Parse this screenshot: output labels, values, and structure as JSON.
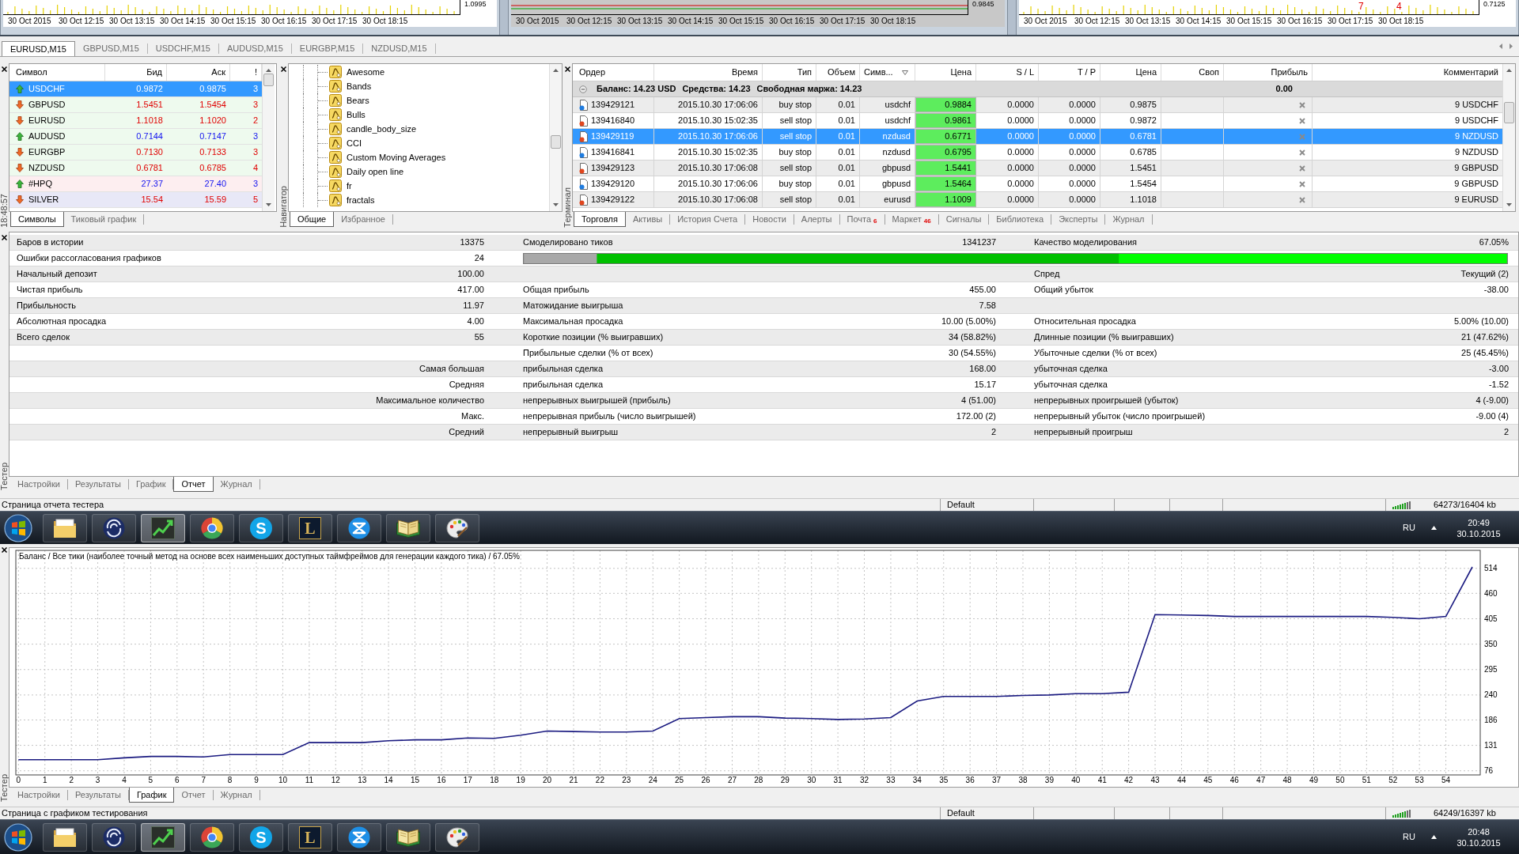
{
  "top_charts": [
    {
      "kind": "volumes",
      "price_label": "1.0995",
      "time_labels": [
        "30 Oct 2015",
        "30 Oct 12:15",
        "30 Oct 13:15",
        "30 Oct 14:15",
        "30 Oct 15:15",
        "30 Oct 16:15",
        "30 Oct 17:15",
        "30 Oct 18:15"
      ]
    },
    {
      "kind": "levels",
      "price_label": "0.9845",
      "time_labels": [
        "30 Oct 2015",
        "30 Oct 12:15",
        "30 Oct 13:15",
        "30 Oct 14:15",
        "30 Oct 15:15",
        "30 Oct 16:15",
        "30 Oct 17:15",
        "30 Oct 18:15"
      ]
    },
    {
      "kind": "markers",
      "price_label": "0.7125",
      "markers": [
        "7",
        "4"
      ],
      "time_labels": [
        "30 Oct 2015",
        "30 Oct 12:15",
        "30 Oct 13:15",
        "30 Oct 14:15",
        "30 Oct 15:15",
        "30 Oct 16:15",
        "30 Oct 17:15",
        "30 Oct 18:15"
      ]
    }
  ],
  "chart_tabs": [
    {
      "label": "EURUSD,M15",
      "selected": true
    },
    {
      "label": "GBPUSD,M15",
      "selected": false
    },
    {
      "label": "USDCHF,M15",
      "selected": false
    },
    {
      "label": "AUDUSD,M15",
      "selected": false
    },
    {
      "label": "EURGBP,M15",
      "selected": false
    },
    {
      "label": "NZDUSD,M15",
      "selected": false
    }
  ],
  "market_watch": {
    "clock": "18:48:57",
    "columns": [
      "Символ",
      "Бид",
      "Аск",
      "!"
    ],
    "rows": [
      {
        "symbol": "USDCHF",
        "bid": "0.9872",
        "ask": "0.9875",
        "spread": "3",
        "rising": true,
        "selected": true
      },
      {
        "symbol": "GBPUSD",
        "bid": "1.5451",
        "ask": "1.5454",
        "spread": "3",
        "rising": false,
        "selected": false,
        "color": "#eefaee"
      },
      {
        "symbol": "EURUSD",
        "bid": "1.1018",
        "ask": "1.1020",
        "spread": "2",
        "rising": false,
        "selected": false,
        "color": "#eefaee"
      },
      {
        "symbol": "AUDUSD",
        "bid": "0.7144",
        "ask": "0.7147",
        "spread": "3",
        "rising": true,
        "selected": false,
        "color": "#eefaee"
      },
      {
        "symbol": "EURGBP",
        "bid": "0.7130",
        "ask": "0.7133",
        "spread": "3",
        "rising": false,
        "selected": false,
        "color": "#eefaee"
      },
      {
        "symbol": "NZDUSD",
        "bid": "0.6781",
        "ask": "0.6785",
        "spread": "4",
        "rising": false,
        "selected": false,
        "color": "#eefaee"
      },
      {
        "symbol": "#HPQ",
        "bid": "27.37",
        "ask": "27.40",
        "spread": "3",
        "rising": true,
        "selected": false,
        "color": "#fdeef0"
      },
      {
        "symbol": "SILVER",
        "bid": "15.54",
        "ask": "15.59",
        "spread": "5",
        "rising": false,
        "selected": false,
        "color": "#e8e8f7"
      }
    ],
    "tabs": [
      {
        "label": "Символы",
        "selected": true
      },
      {
        "label": "Тиковый график",
        "selected": false
      }
    ]
  },
  "navigator": {
    "title": "Навигатор",
    "items": [
      "Awesome",
      "Bands",
      "Bears",
      "Bulls",
      "candle_body_size",
      "CCI",
      "Custom Moving Averages",
      "Daily open line",
      "fr",
      "fractals"
    ],
    "tabs": [
      {
        "label": "Общие",
        "selected": true
      },
      {
        "label": "Избранное",
        "selected": false
      }
    ]
  },
  "terminal": {
    "title": "Терминал",
    "columns": [
      "Ордер",
      "Время",
      "Тип",
      "Объем",
      "Симв...",
      "Цена",
      "S / L",
      "T / P",
      "Цена",
      "Своп",
      "Прибыль",
      "Комментарий"
    ],
    "summary": [
      "Баланс: 14.23 USD",
      "Средства: 14.23",
      "Свободная маржа: 14.23"
    ],
    "summary_profit": "0.00",
    "rows": [
      {
        "kind": "buy",
        "selected": false,
        "order": "139429121",
        "time": "2015.10.30 17:06:06",
        "type": "buy stop",
        "volume": "0.01",
        "symbol": "usdchf",
        "price": "0.9884",
        "sl": "0.0000",
        "tp": "0.0000",
        "current_price": "0.9875",
        "comment": "9 USDCHF"
      },
      {
        "kind": "sell",
        "selected": false,
        "order": "139416840",
        "time": "2015.10.30 15:02:35",
        "type": "sell stop",
        "volume": "0.01",
        "symbol": "usdchf",
        "price": "0.9861",
        "sl": "0.0000",
        "tp": "0.0000",
        "current_price": "0.9872",
        "comment": "9 USDCHF"
      },
      {
        "kind": "sell",
        "selected": true,
        "order": "139429119",
        "time": "2015.10.30 17:06:06",
        "type": "sell stop",
        "volume": "0.01",
        "symbol": "nzdusd",
        "price": "0.6771",
        "sl": "0.0000",
        "tp": "0.0000",
        "current_price": "0.6781",
        "comment": "9 NZDUSD"
      },
      {
        "kind": "buy",
        "selected": false,
        "order": "139416841",
        "time": "2015.10.30 15:02:35",
        "type": "buy stop",
        "volume": "0.01",
        "symbol": "nzdusd",
        "price": "0.6795",
        "sl": "0.0000",
        "tp": "0.0000",
        "current_price": "0.6785",
        "comment": "9 NZDUSD"
      },
      {
        "kind": "sell",
        "selected": false,
        "order": "139429123",
        "time": "2015.10.30 17:06:08",
        "type": "sell stop",
        "volume": "0.01",
        "symbol": "gbpusd",
        "price": "1.5441",
        "sl": "0.0000",
        "tp": "0.0000",
        "current_price": "1.5451",
        "comment": "9 GBPUSD"
      },
      {
        "kind": "buy",
        "selected": false,
        "order": "139429120",
        "time": "2015.10.30 17:06:06",
        "type": "buy stop",
        "volume": "0.01",
        "symbol": "gbpusd",
        "price": "1.5464",
        "sl": "0.0000",
        "tp": "0.0000",
        "current_price": "1.5454",
        "comment": "9 GBPUSD"
      },
      {
        "kind": "sell",
        "selected": false,
        "order": "139429122",
        "time": "2015.10.30 17:06:08",
        "type": "sell stop",
        "volume": "0.01",
        "symbol": "eurusd",
        "price": "1.1009",
        "sl": "0.0000",
        "tp": "0.0000",
        "current_price": "1.1018",
        "comment": "9 EURUSD"
      }
    ],
    "tabs": [
      {
        "label": "Торговля",
        "selected": true
      },
      {
        "label": "Активы",
        "selected": false
      },
      {
        "label": "История Счета",
        "selected": false
      },
      {
        "label": "Новости",
        "selected": false
      },
      {
        "label": "Алерты",
        "selected": false
      },
      {
        "label": "Почта",
        "count": "6",
        "selected": false
      },
      {
        "label": "Маркет",
        "count": "46",
        "selected": false
      },
      {
        "label": "Сигналы",
        "selected": false
      },
      {
        "label": "Библиотека",
        "selected": false
      },
      {
        "label": "Эксперты",
        "selected": false
      },
      {
        "label": "Журнал",
        "selected": false
      }
    ]
  },
  "tester_report": {
    "title": "Тестер",
    "rows": [
      {
        "kind": "text",
        "label": "Баров в истории",
        "value": "13375",
        "label_2": "Смоделировано тиков",
        "value_2": "1341237",
        "label_3": "Качество моделирования",
        "value_3": "67.05%"
      },
      {
        "kind": "quality_bar",
        "label": "Ошибки рассогласования графиков",
        "value": "24"
      },
      {
        "kind": "text",
        "label": "Начальный депозит",
        "value": "100.00",
        "label_3": "Спред",
        "value_3": "Текущий (2)"
      },
      {
        "kind": "text",
        "label": "Чистая прибыль",
        "value": "417.00",
        "label_2": "Общая прибыль",
        "value_2": "455.00",
        "label_3": "Общий убыток",
        "value_3": "-38.00"
      },
      {
        "kind": "text",
        "label": "Прибыльность",
        "value": "11.97",
        "label_2": "Матожидание выигрыша",
        "value_2": "7.58"
      },
      {
        "kind": "text",
        "label": "Абсолютная просадка",
        "value": "4.00",
        "label_2": "Максимальная просадка",
        "value_2": "10.00 (5.00%)",
        "label_3": "Относительная просадка",
        "value_3": "5.00% (10.00)"
      },
      {
        "kind": "text",
        "label": "Всего сделок",
        "value": "55",
        "label_2": "Короткие позиции (% выигравших)",
        "value_2": "34 (58.82%)",
        "label_3": "Длинные позиции (% выигравших)",
        "value_3": "21 (47.62%)"
      },
      {
        "kind": "text",
        "label_2": "Прибыльные сделки (% от всех)",
        "value_2": "30 (54.55%)",
        "label_3": "Убыточные сделки (% от всех)",
        "value_3": "25 (45.45%)"
      },
      {
        "kind": "text",
        "value": "Самая большая",
        "label_2": "прибыльная сделка",
        "value_2": "168.00",
        "label_3": "убыточная сделка",
        "value_3": "-3.00"
      },
      {
        "kind": "text",
        "value": "Средняя",
        "label_2": "прибыльная сделка",
        "value_2": "15.17",
        "label_3": "убыточная сделка",
        "value_3": "-1.52"
      },
      {
        "kind": "text",
        "value": "Максимальное количество",
        "label_2": "непрерывных выигрышей (прибыль)",
        "value_2": "4 (51.00)",
        "label_3": "непрерывных проигрышей (убыток)",
        "value_3": "4 (-9.00)"
      },
      {
        "kind": "text",
        "value": "Макс.",
        "label_2": "непрерывная прибыль (число выигрышей)",
        "value_2": "172.00 (2)",
        "label_3": "непрерывный убыток (число проигрышей)",
        "value_3": "-9.00 (4)"
      },
      {
        "kind": "text",
        "value": "Средний",
        "label_2": "непрерывный выигрыш",
        "value_2": "2",
        "label_3": "непрерывный проигрыш",
        "value_3": "2"
      }
    ],
    "tabs": [
      {
        "label": "Настройки",
        "selected": false
      },
      {
        "label": "Результаты",
        "selected": false
      },
      {
        "label": "График",
        "selected": false
      },
      {
        "label": "Отчет",
        "selected": true
      },
      {
        "label": "Журнал",
        "selected": false
      }
    ]
  },
  "status_bar_1": {
    "message": "Страница отчета тестера",
    "profile": "Default",
    "traffic": "64273/16404 kb"
  },
  "taskbar_1": {
    "apps": [
      {
        "kind": "folder",
        "selected": false
      },
      {
        "kind": "swirl",
        "selected": false
      },
      {
        "kind": "chart",
        "selected": true
      },
      {
        "kind": "ring",
        "selected": false
      },
      {
        "kind": "letter",
        "glyph": "S",
        "selected": false
      },
      {
        "kind": "letter_tile",
        "glyph": "L",
        "selected": false
      },
      {
        "kind": "bowtie",
        "selected": false
      },
      {
        "kind": "book",
        "selected": false
      },
      {
        "kind": "palette",
        "selected": false
      }
    ],
    "language": "RU",
    "time": "20:49",
    "date": "30.10.2015"
  },
  "tester_graph": {
    "title": "Тестер",
    "chart_data": [
      {
        "type": "line",
        "title": "Баланс / Все тики (наиболее точный метод на основе всех наименьших доступных таймфреймов для генерации каждого тика) / 67.05%",
        "x": [
          0,
          1,
          2,
          3,
          4,
          5,
          6,
          7,
          8,
          9,
          10,
          11,
          12,
          13,
          14,
          15,
          16,
          17,
          18,
          19,
          20,
          21,
          22,
          23,
          24,
          25,
          26,
          27,
          28,
          29,
          30,
          31,
          32,
          33,
          34,
          35,
          36,
          37,
          38,
          39,
          40,
          41,
          42,
          43,
          44,
          45,
          46,
          47,
          48,
          49,
          50,
          51,
          52,
          53,
          54,
          55
        ],
        "values": [
          100,
          100,
          100,
          100,
          104,
          107,
          107,
          106,
          111,
          111,
          111,
          137,
          137,
          137,
          141,
          143,
          143,
          147,
          146,
          153,
          162,
          161,
          160,
          160,
          162,
          189,
          191,
          193,
          193,
          190,
          189,
          187,
          188,
          191,
          227,
          237,
          237,
          237,
          239,
          240,
          243,
          243,
          246,
          414,
          413,
          412,
          410,
          410,
          410,
          410,
          410,
          410,
          408,
          405,
          410,
          517
        ],
        "color": "#1a1a80",
        "xlim": [
          -0.1,
          55.3
        ],
        "ylim": [
          67,
          553
        ],
        "xticks": [
          0,
          1,
          2,
          3,
          4,
          5,
          6,
          7,
          8,
          9,
          10,
          11,
          12,
          13,
          14,
          15,
          16,
          17,
          18,
          19,
          20,
          21,
          22,
          23,
          24,
          25,
          26,
          27,
          28,
          29,
          30,
          31,
          32,
          33,
          34,
          35,
          36,
          37,
          38,
          39,
          40,
          41,
          42,
          43,
          44,
          45,
          46,
          47,
          48,
          49,
          50,
          51,
          52,
          53,
          54
        ],
        "yticks": [
          76,
          131,
          186,
          240,
          295,
          350,
          405,
          460,
          514
        ],
        "grid": true
      }
    ],
    "tabs": [
      {
        "label": "Настройки",
        "selected": false
      },
      {
        "label": "Результаты",
        "selected": false
      },
      {
        "label": "График",
        "selected": true
      },
      {
        "label": "Отчет",
        "selected": false
      },
      {
        "label": "Журнал",
        "selected": false
      }
    ]
  },
  "status_bar_2": {
    "message": "Страница с графиком тестирования",
    "profile": "Default",
    "traffic": "64249/16397 kb"
  },
  "taskbar_2": {
    "apps": [
      {
        "kind": "folder",
        "selected": false
      },
      {
        "kind": "swirl",
        "selected": false
      },
      {
        "kind": "chart",
        "selected": true
      },
      {
        "kind": "ring",
        "selected": false
      },
      {
        "kind": "letter",
        "glyph": "S",
        "selected": false
      },
      {
        "kind": "letter_tile",
        "glyph": "L",
        "selected": false
      },
      {
        "kind": "bowtie",
        "selected": false
      },
      {
        "kind": "book",
        "selected": false
      },
      {
        "kind": "palette",
        "selected": false
      }
    ],
    "language": "RU",
    "time": "20:48",
    "date": "30.10.2015"
  }
}
